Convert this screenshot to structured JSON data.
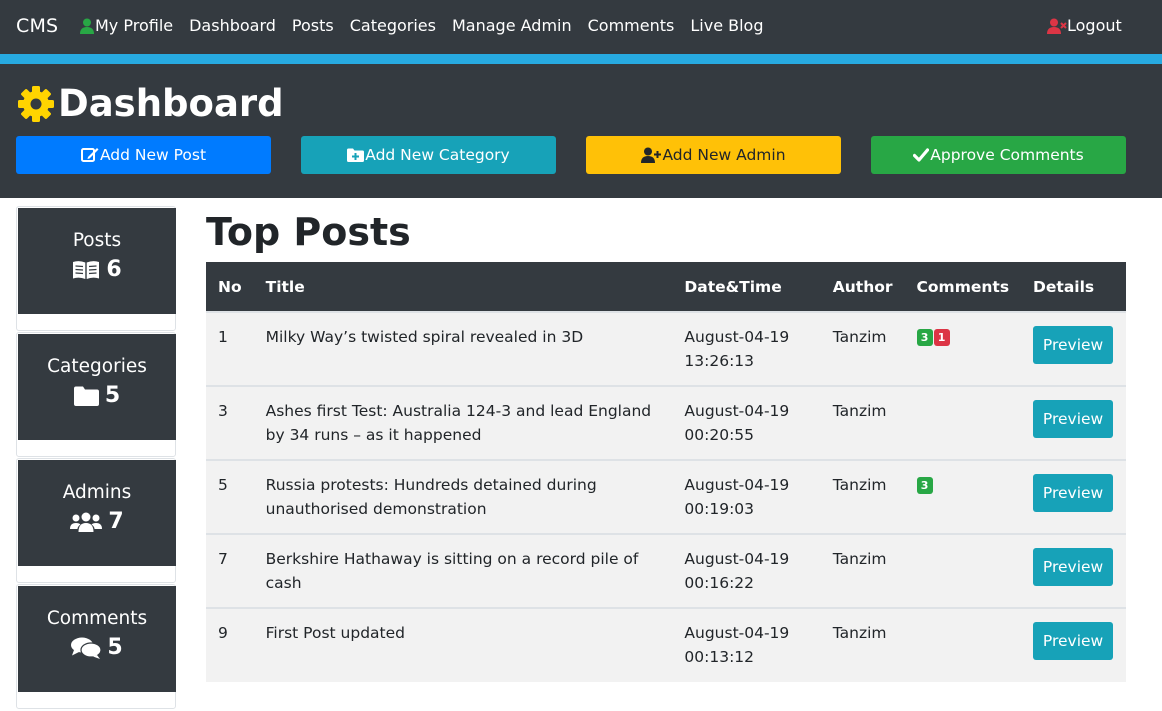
{
  "navbar": {
    "brand": "CMS",
    "links": [
      {
        "label": "My Profile",
        "icon": "user-icon"
      },
      {
        "label": "Dashboard"
      },
      {
        "label": "Posts"
      },
      {
        "label": "Categories"
      },
      {
        "label": "Manage Admin"
      },
      {
        "label": "Comments"
      },
      {
        "label": "Live Blog"
      }
    ],
    "logout": {
      "label": "Logout",
      "icon": "user-times-icon"
    }
  },
  "header": {
    "title": "Dashboard",
    "title_icon": "gear-icon",
    "buttons": [
      {
        "label": "Add New Post",
        "icon": "edit-icon"
      },
      {
        "label": "Add New Category",
        "icon": "folder-plus-icon"
      },
      {
        "label": "Add New Admin",
        "icon": "user-plus-icon"
      },
      {
        "label": "Approve Comments",
        "icon": "check-icon"
      }
    ]
  },
  "stats": [
    {
      "label": "Posts",
      "value": "6",
      "icon": "book-icon"
    },
    {
      "label": "Categories",
      "value": "5",
      "icon": "folder-icon"
    },
    {
      "label": "Admins",
      "value": "7",
      "icon": "users-icon"
    },
    {
      "label": "Comments",
      "value": "5",
      "icon": "comments-icon"
    }
  ],
  "top_posts": {
    "title": "Top Posts",
    "columns": [
      "No",
      "Title",
      "Date&Time",
      "Author",
      "Comments",
      "Details"
    ],
    "rows": [
      {
        "no": "1",
        "title": "Milky Way’s twisted spiral revealed in 3D",
        "date": "August-04-19",
        "time": "13:26:13",
        "author": "Tanzim",
        "approved": "3",
        "pending": "1",
        "action": "Preview"
      },
      {
        "no": "3",
        "title": "Ashes first Test: Australia 124-3 and lead England by 34 runs – as it happened",
        "date": "August-04-19",
        "time": "00:20:55",
        "author": "Tanzim",
        "approved": "",
        "pending": "",
        "action": "Preview"
      },
      {
        "no": "5",
        "title": "Russia protests: Hundreds detained during unauthorised demonstration",
        "date": "August-04-19",
        "time": "00:19:03",
        "author": "Tanzim",
        "approved": "3",
        "pending": "",
        "action": "Preview"
      },
      {
        "no": "7",
        "title": "Berkshire Hathaway is sitting on a record pile of cash",
        "date": "August-04-19",
        "time": "00:16:22",
        "author": "Tanzim",
        "approved": "",
        "pending": "",
        "action": "Preview"
      },
      {
        "no": "9",
        "title": "First Post updated",
        "date": "August-04-19",
        "time": "00:13:12",
        "author": "Tanzim",
        "approved": "",
        "pending": "",
        "action": "Preview"
      }
    ]
  },
  "colors": {
    "nav_bg": "#343a40",
    "accent": "#27aae1",
    "primary": "#007bff",
    "info": "#17a2b8",
    "warning": "#ffc107",
    "success": "#28a745",
    "danger": "#dc3545",
    "gear": "#ffd400"
  }
}
